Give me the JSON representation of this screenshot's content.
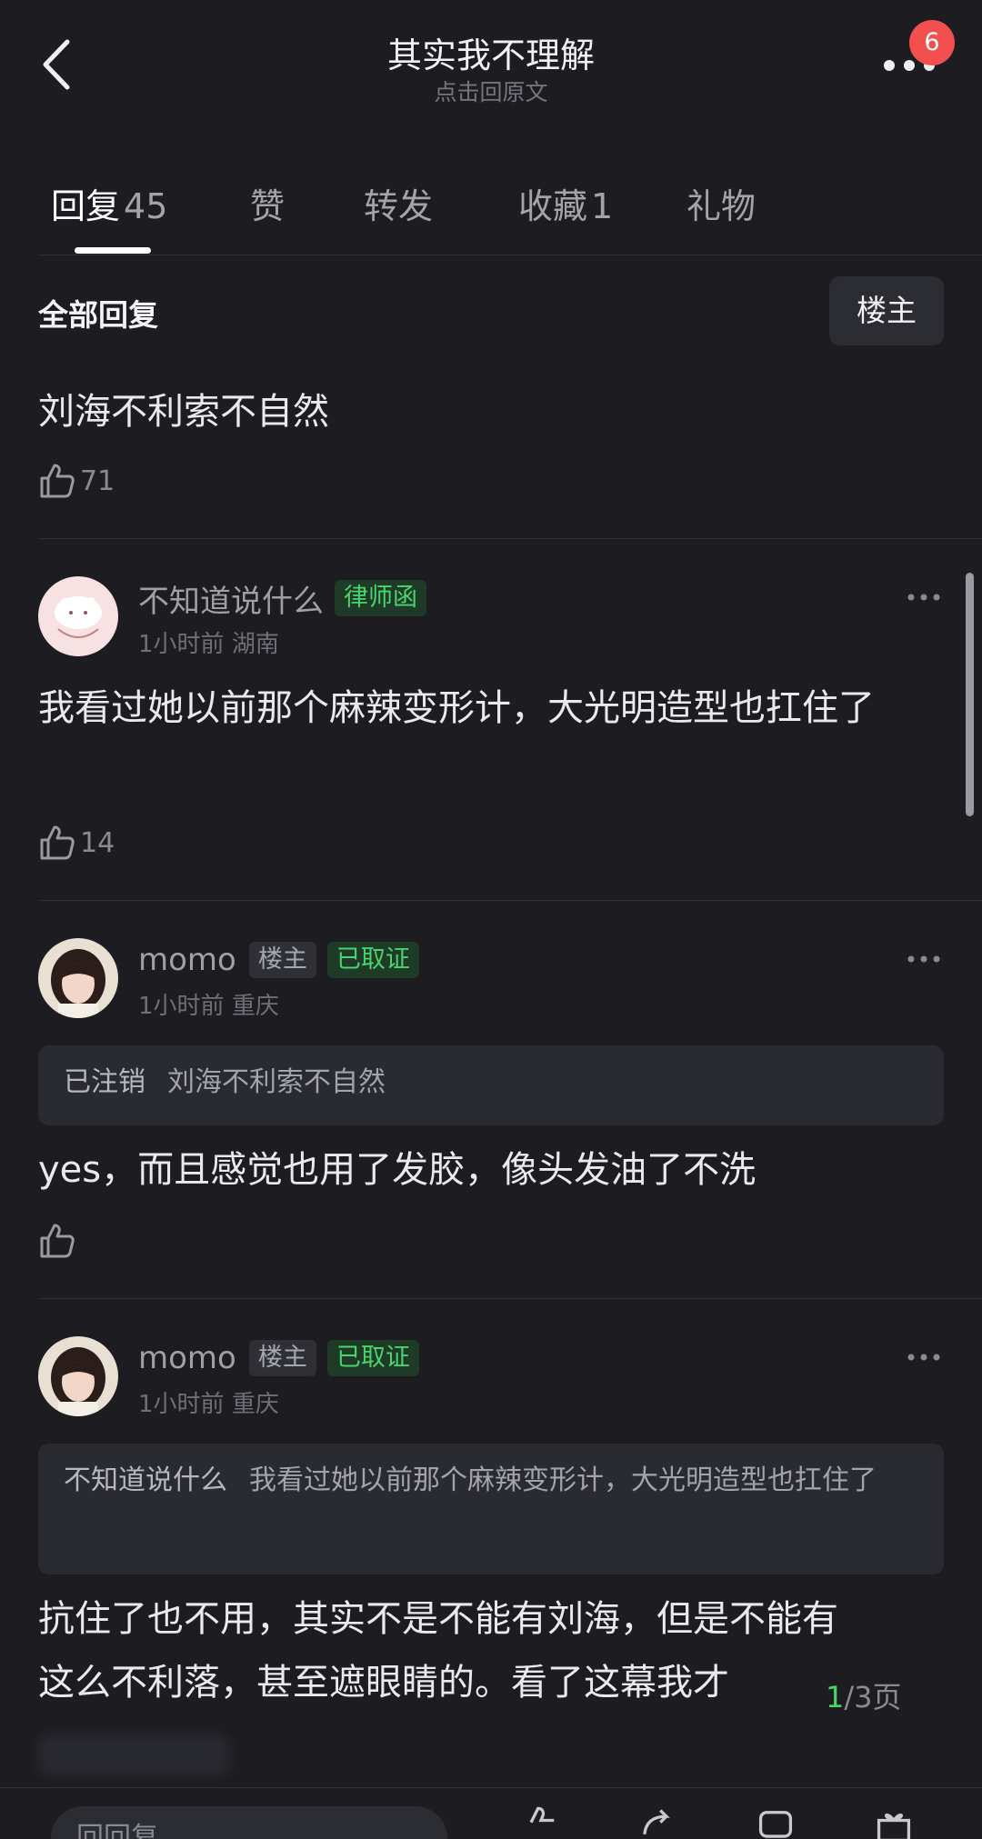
{
  "header": {
    "title": "其实我不理解",
    "subtitle": "点击回原文",
    "notification_count": "6"
  },
  "tabs": [
    {
      "label": "回复",
      "count": "45",
      "active": true
    },
    {
      "label": "赞",
      "count": ""
    },
    {
      "label": "转发",
      "count": ""
    },
    {
      "label": "收藏",
      "count": "1"
    },
    {
      "label": "礼物",
      "count": ""
    }
  ],
  "section": {
    "title": "全部回复",
    "filter_label": "楼主"
  },
  "original_comment": {
    "text": "刘海不利索不自然",
    "likes": "71"
  },
  "replies": [
    {
      "name": "不知道说什么",
      "tags": [
        {
          "label": "律师函",
          "style": "green"
        }
      ],
      "time": "1小时前",
      "location": "湖南",
      "text": "我看过她以前那个麻辣变形计，大光明造型也扛住了",
      "likes": "14"
    },
    {
      "name": "momo",
      "tags": [
        {
          "label": "楼主",
          "style": "gray"
        },
        {
          "label": "已取证",
          "style": "green"
        }
      ],
      "time": "1小时前",
      "location": "重庆",
      "quote_name": "已注销",
      "quote_text": "刘海不利索不自然",
      "text": "yes，而且感觉也用了发胶，像头发油了不洗",
      "likes": ""
    },
    {
      "name": "momo",
      "tags": [
        {
          "label": "楼主",
          "style": "gray"
        },
        {
          "label": "已取证",
          "style": "green"
        }
      ],
      "time": "1小时前",
      "location": "重庆",
      "quote_name": "不知道说什么",
      "quote_text": "我看过她以前那个麻辣变形计，大光明造型也扛住了",
      "text": "抗住了也不用，其实不是不能有刘海，但是不能有这么不利落，甚至遮眼睛的。看了这幕我才"
    }
  ],
  "pagination": {
    "current": "1",
    "total_text": "/3页"
  },
  "bottom_bar": {
    "reply_placeholder": "回回复"
  },
  "colors": {
    "background": "#1c1c21",
    "accent_green": "#4ad46d",
    "badge_red": "#f24f4f"
  }
}
